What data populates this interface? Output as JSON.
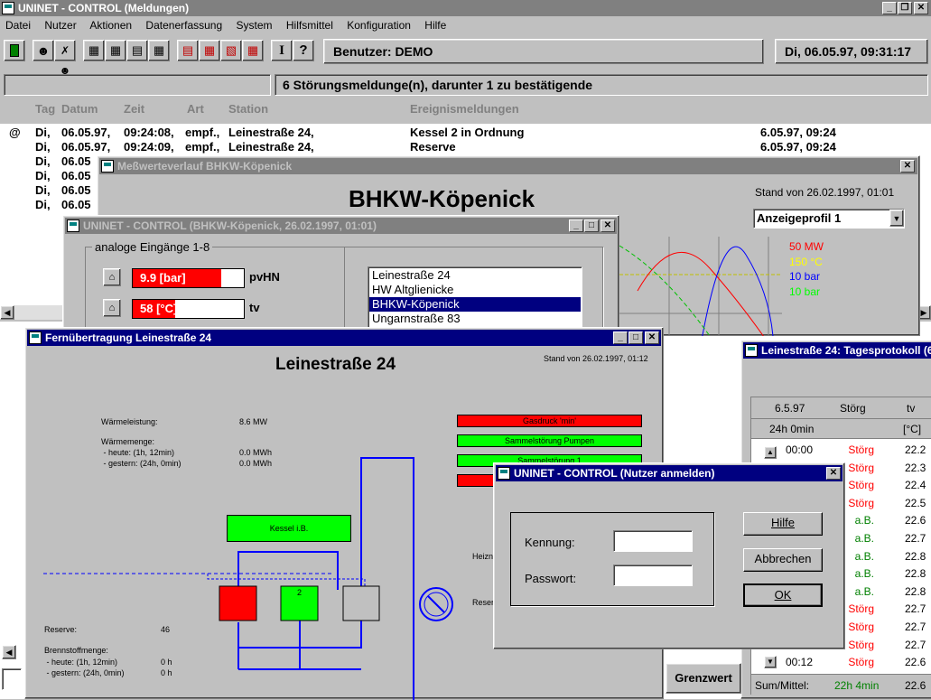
{
  "main": {
    "title": "UNINET - CONTROL (Meldungen)",
    "menu": [
      "Datei",
      "Nutzer",
      "Aktionen",
      "Datenerfassung",
      "System",
      "Hilfsmittel",
      "Konfiguration",
      "Hilfe"
    ],
    "toolbar_icons": [
      "exit-icon",
      "user-login-icon",
      "user-logout-icon",
      "grid-1-icon",
      "grid-2-icon",
      "grid-3-icon",
      "table-1-icon",
      "table-red-1-icon",
      "table-red-2-icon",
      "chart-red-icon",
      "table-red-3-icon",
      "info-icon",
      "help-icon"
    ],
    "toolbar_i": "I",
    "toolbar_q": "?",
    "user": "Benutzer: DEMO",
    "datetime": "Di, 06.05.97,  09:31:17",
    "status": "6 Störungsmeldunge(n), darunter 1 zu bestätigende",
    "columns": [
      "Tag",
      "Datum",
      "Zeit",
      "Art",
      "Station",
      "Ereignismeldungen"
    ],
    "rows": [
      {
        "mark": "@",
        "day": "Di,",
        "date": "06.05.97,",
        "time": "09:24:08,",
        "kind": "empf.,",
        "station": "Leinestraße 24,",
        "event": "Kessel 2 in Ordnung",
        "ts": "6.05.97, 09:24"
      },
      {
        "mark": "",
        "day": "Di,",
        "date": "06.05.97,",
        "time": "09:24:09,",
        "kind": "empf.,",
        "station": "Leinestraße 24,",
        "event": "Reserve",
        "ts": "6.05.97, 09:24"
      },
      {
        "mark": "",
        "day": "Di,",
        "date": "06.05",
        "time": "",
        "kind": "",
        "station": "",
        "event": "",
        "ts": ""
      },
      {
        "mark": "",
        "day": "Di,",
        "date": "06.05",
        "time": "",
        "kind": "",
        "station": "",
        "event": "",
        "ts": ""
      },
      {
        "mark": "",
        "day": "Di,",
        "date": "06.05",
        "time": "",
        "kind": "",
        "station": "",
        "event": "",
        "ts": ""
      },
      {
        "mark": "",
        "day": "Di,",
        "date": "06.05",
        "time": "",
        "kind": "",
        "station": "",
        "event": "",
        "ts": ""
      }
    ]
  },
  "messwert": {
    "title": "Meßwerteverlauf BHKW-Köpenick",
    "heading": "BHKW-Köpenick",
    "stand": "Stand von 26.02.1997, 01:01",
    "profile": "Anzeigeprofil 1",
    "legend": [
      {
        "label": "50 MW",
        "color": "#ff0000"
      },
      {
        "label": "150 °C",
        "color": "#ffff00"
      },
      {
        "label": "10 bar",
        "color": "#0000ff"
      },
      {
        "label": "10 bar",
        "color": "#00ff00"
      }
    ]
  },
  "bhkw": {
    "title": "UNINET - CONTROL (BHKW-Köpenick, 26.02.1997, 01:01)",
    "group": "analoge Eingänge 1-8",
    "inputs": [
      {
        "value": "9.9 [bar]",
        "label": "pvHN",
        "fill": 0.8
      },
      {
        "value": "58 [°C]",
        "label": "tv",
        "fill": 0.38
      }
    ],
    "stations": [
      "Leinestraße 24",
      "HW Altglienicke",
      "BHKW-Köpenick",
      "Ungarnstraße 83"
    ],
    "selected": 2
  },
  "fern": {
    "title": "Fernübertragung Leinestraße 24",
    "heading": "Leinestraße 24",
    "stand": "Stand von 26.02.1997, 01:12",
    "waermeleistung_label": "Wärmeleistung:",
    "waermeleistung": "8.6 MW",
    "waermemenge": "Wärmemenge:",
    "heute_label": " - heute: (1h, 12min)",
    "heute": "0.0 MWh",
    "gestern_label": " - gestern: (24h, 0min)",
    "gestern": "0.0 MWh",
    "alarms": [
      {
        "text": "Gasdruck 'min'",
        "color": "#ff0000"
      },
      {
        "text": "Sammelstörung Pumpen",
        "color": "#00ff00"
      },
      {
        "text": "Sammelstörung 1",
        "color": "#00ff00"
      },
      {
        "text": "",
        "color": "#ff0000"
      }
    ],
    "kessel": "Kessel i.B.",
    "heizn": "Heizne",
    "reserve_right": "Reser",
    "pump2": "2",
    "reserve_label": "Reserve:",
    "reserve_value": "46",
    "brennstoff": "Brennstoffmenge:",
    "b_heute_label": " - heute: (1h, 12min)",
    "b_heute": "0 h",
    "b_gestern_label": " - gestern: (24h, 0min)",
    "b_gestern": "0 h"
  },
  "tages": {
    "title": "Leinestraße 24: Tagesprotokoll (6",
    "head": [
      "6.5.97",
      "Störg",
      "tv"
    ],
    "subhead": [
      "24h 0min",
      "",
      "[°C]"
    ],
    "rows": [
      {
        "time": "00:00",
        "state": "Störg",
        "val": "22.2"
      },
      {
        "time": "",
        "state": "Störg",
        "val": "22.3"
      },
      {
        "time": "",
        "state": "Störg",
        "val": "22.4"
      },
      {
        "time": "",
        "state": "Störg",
        "val": "22.5"
      },
      {
        "time": "",
        "state": "a.B.",
        "val": "22.6"
      },
      {
        "time": "",
        "state": "a.B.",
        "val": "22.7"
      },
      {
        "time": "",
        "state": "a.B.",
        "val": "22.8"
      },
      {
        "time": "",
        "state": "a.B.",
        "val": "22.8"
      },
      {
        "time": "",
        "state": "a.B.",
        "val": "22.8"
      },
      {
        "time": "",
        "state": "Störg",
        "val": "22.7"
      },
      {
        "time": "",
        "state": "Störg",
        "val": "22.7"
      },
      {
        "time": "",
        "state": "Störg",
        "val": "22.7"
      },
      {
        "time": "00:12",
        "state": "Störg",
        "val": "22.6"
      }
    ],
    "sum_label": "Sum/Mittel:",
    "sum_time": "22h 4min",
    "sum_val": "22.6",
    "grenzwert": "Grenzwert"
  },
  "login": {
    "title": "UNINET - CONTROL (Nutzer anmelden)",
    "kennung": "Kennung:",
    "passwort": "Passwort:",
    "help": "Hilfe",
    "cancel": "Abbrechen",
    "ok": "OK"
  },
  "colors": {
    "titlebar": "#000080",
    "desktop": "#c0c0c0",
    "alarm": "#ff0000",
    "ok": "#00ff00"
  }
}
